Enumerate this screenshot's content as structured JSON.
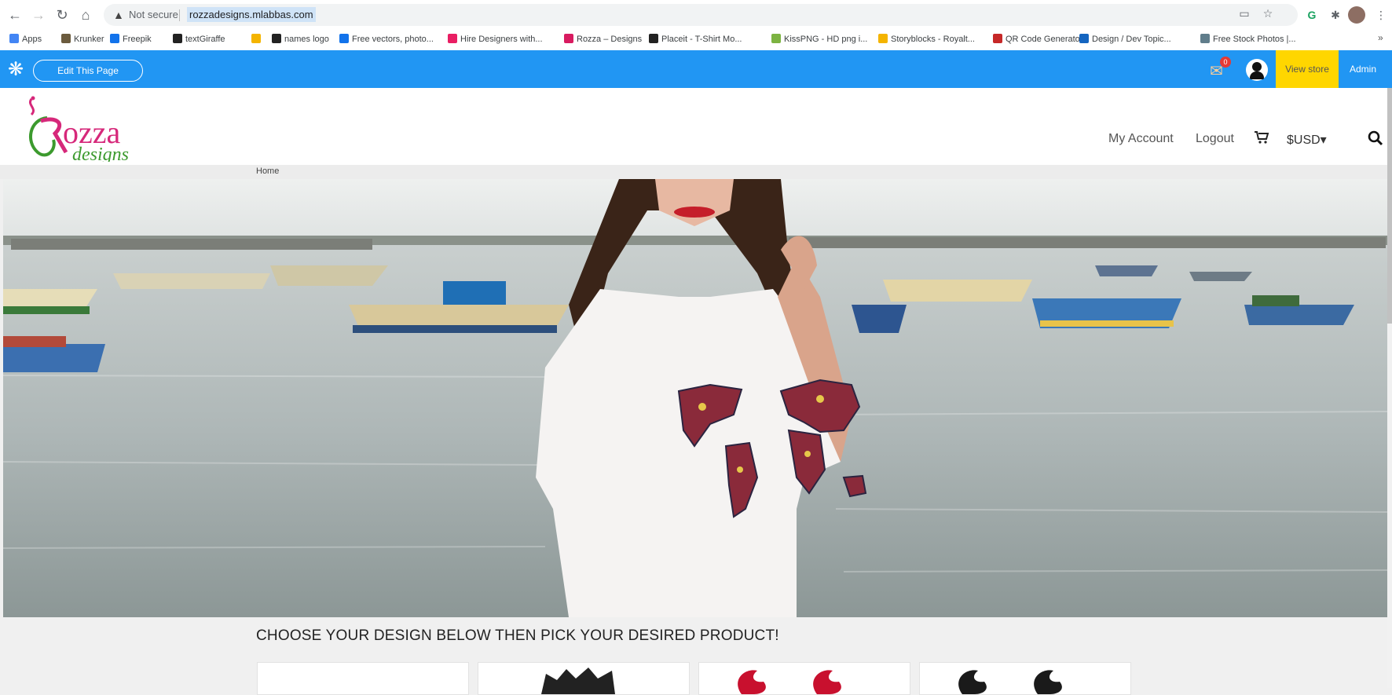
{
  "browser": {
    "security_label": "Not secure",
    "url": "rozzadesigns.mlabbas.com"
  },
  "bookmarks": [
    {
      "label": "Apps",
      "color": "#4285f4"
    },
    {
      "label": "Krunker",
      "color": "#6b5b3e"
    },
    {
      "label": "Freepik",
      "color": "#1273eb"
    },
    {
      "label": "textGiraffe",
      "color": "#222222"
    },
    {
      "label": "",
      "color": "#f4b400"
    },
    {
      "label": "names logo",
      "color": "#222222"
    },
    {
      "label": "Free vectors, photo...",
      "color": "#1273eb"
    },
    {
      "label": "Hire Designers with...",
      "color": "#e91e63"
    },
    {
      "label": "Rozza – Designs",
      "color": "#d81b60"
    },
    {
      "label": "Placeit - T-Shirt Mo...",
      "color": "#222222"
    },
    {
      "label": "KissPNG - HD png i...",
      "color": "#7cb342"
    },
    {
      "label": "Storyblocks - Royalt...",
      "color": "#f4b400"
    },
    {
      "label": "QR Code Generator",
      "color": "#c62828"
    },
    {
      "label": "Design / Dev Topic...",
      "color": "#1565c0"
    },
    {
      "label": "Free Stock Photos |...",
      "color": "#607d8b"
    }
  ],
  "admin_bar": {
    "edit_label": "Edit This Page",
    "notification_count": "0",
    "view_store_label": "View store",
    "admin_label": "Admin"
  },
  "site": {
    "logo_main": "ozza",
    "logo_sub": "designs",
    "nav": {
      "my_account": "My Account",
      "logout": "Logout",
      "currency": "$USD▾"
    },
    "breadcrumb": "Home",
    "section_heading": "CHOOSE YOUR DESIGN BELOW THEN PICK YOUR DESIRED PRODUCT!"
  },
  "colors": {
    "admin_bar": "#2196f3",
    "view_store": "#ffd600",
    "logo_pink": "#d6287a",
    "logo_green": "#3c9a2e"
  }
}
